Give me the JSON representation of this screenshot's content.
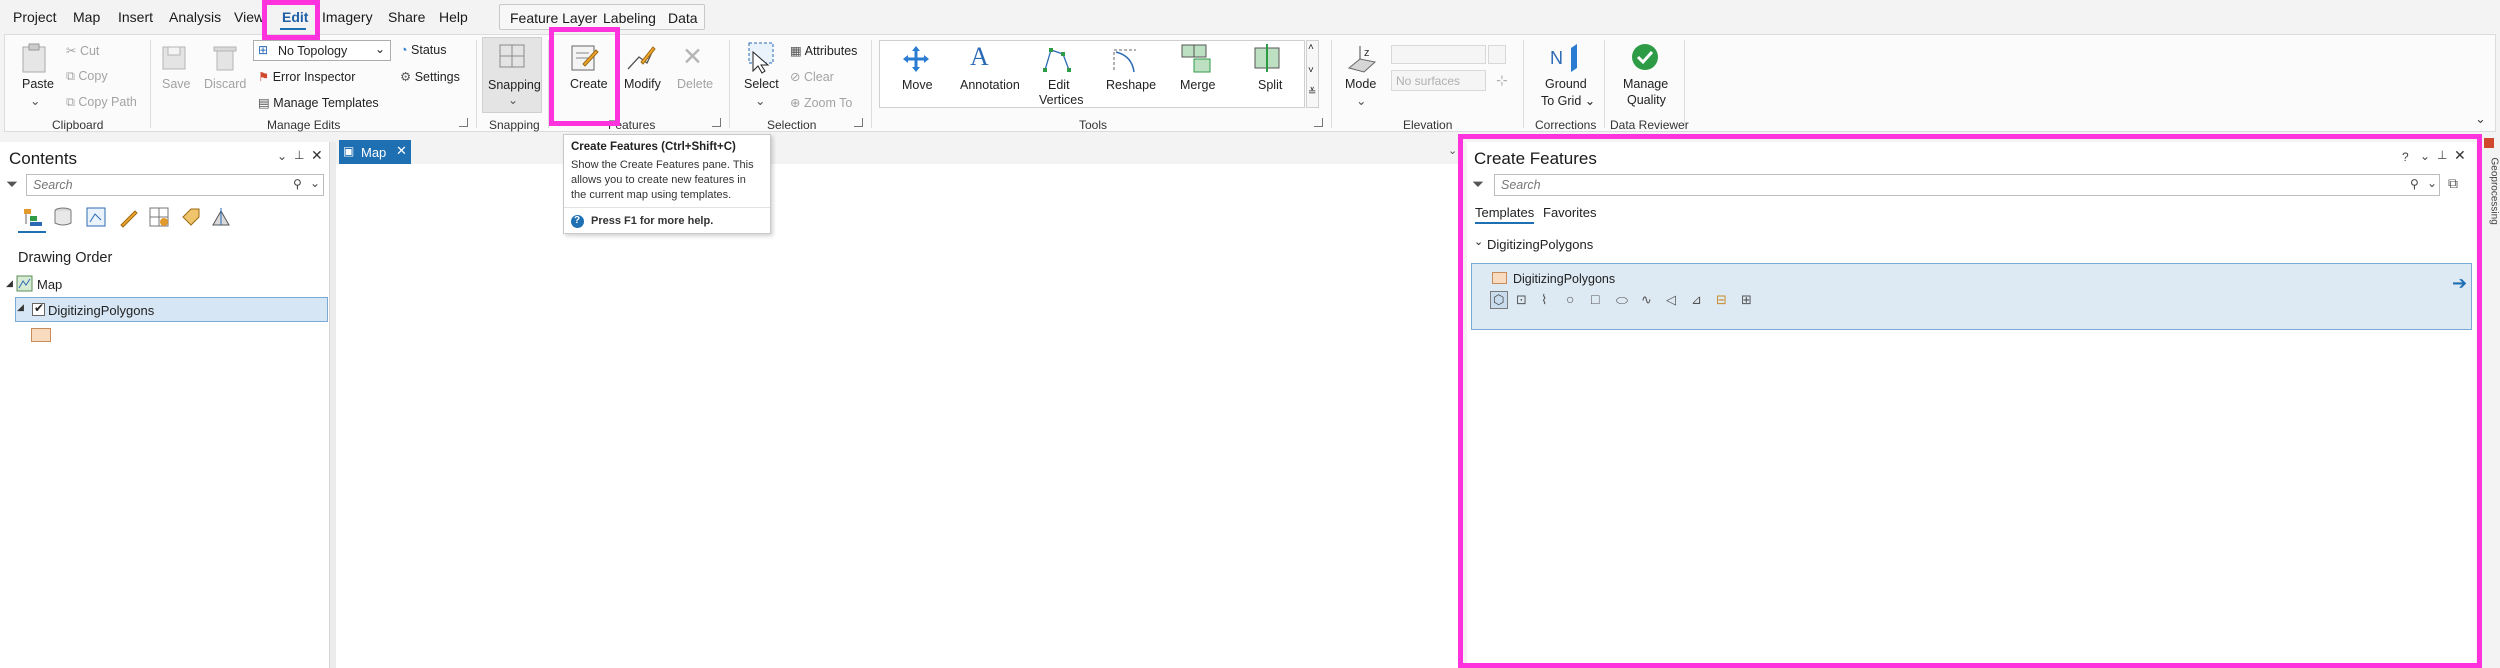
{
  "menubar": {
    "items": [
      "Project",
      "Map",
      "Insert",
      "Analysis",
      "View",
      "Edit",
      "Imagery",
      "Share",
      "Help"
    ],
    "context_tabs": [
      "Feature Layer",
      "Labeling",
      "Data"
    ]
  },
  "ribbon": {
    "clipboard": {
      "paste": "Paste",
      "cut": "Cut",
      "copy": "Copy",
      "copy_path": "Copy Path",
      "label": "Clipboard"
    },
    "manage_edits": {
      "save": "Save",
      "discard": "Discard",
      "topology": "No Topology",
      "status": "Status",
      "error_inspector": "Error Inspector",
      "settings": "Settings",
      "manage_templates": "Manage Templates",
      "label": "Manage Edits"
    },
    "snapping": {
      "snapping": "Snapping",
      "label": "Snapping"
    },
    "features": {
      "create": "Create",
      "modify": "Modify",
      "delete": "Delete",
      "label": "Features"
    },
    "selection": {
      "select": "Select",
      "attributes": "Attributes",
      "clear": "Clear",
      "zoom_to": "Zoom To",
      "label": "Selection"
    },
    "tools": {
      "move": "Move",
      "annotation": "Annotation",
      "edit_vertices_1": "Edit",
      "edit_vertices_2": "Vertices",
      "reshape": "Reshape",
      "merge": "Merge",
      "split": "Split",
      "label": "Tools"
    },
    "elevation": {
      "mode": "Mode",
      "surface_placeholder": "No surfaces",
      "label": "Elevation"
    },
    "corrections": {
      "ground_1": "Ground",
      "ground_2": "To Grid",
      "label": "Corrections"
    },
    "data_reviewer": {
      "manage_1": "Manage",
      "manage_2": "Quality",
      "label": "Data Reviewer"
    }
  },
  "tooltip": {
    "title": "Create Features (Ctrl+Shift+C)",
    "body_1": "Show the Create Features pane.  This",
    "body_2": "allows you to create new features in",
    "body_3": "the current map using templates.",
    "help": "Press F1 for more help."
  },
  "contents": {
    "title": "Contents",
    "search_placeholder": "Search",
    "drawing_order": "Drawing Order",
    "map_label": "Map",
    "layer_name": "DigitizingPolygons",
    "symbol_color": "#f9dcbf"
  },
  "map_tab": {
    "label": "Map"
  },
  "create_features": {
    "title": "Create Features",
    "help": "?",
    "search_placeholder": "Search",
    "tabs": [
      "Templates",
      "Favorites"
    ],
    "group_name": "DigitizingPolygons",
    "template_name": "DigitizingPolygons",
    "tools": [
      "polygon",
      "rectangle",
      "freehand",
      "circle",
      "square",
      "ellipse",
      "trace",
      "right-angle",
      "autocomplete",
      "split-polygon",
      "cut-polygon"
    ]
  },
  "right_strip": {
    "label": "Geoprocessing"
  },
  "colors": {
    "highlight": "#ff33dd",
    "accent": "#1f6fb3",
    "selected_row": "#d6e6f4"
  }
}
